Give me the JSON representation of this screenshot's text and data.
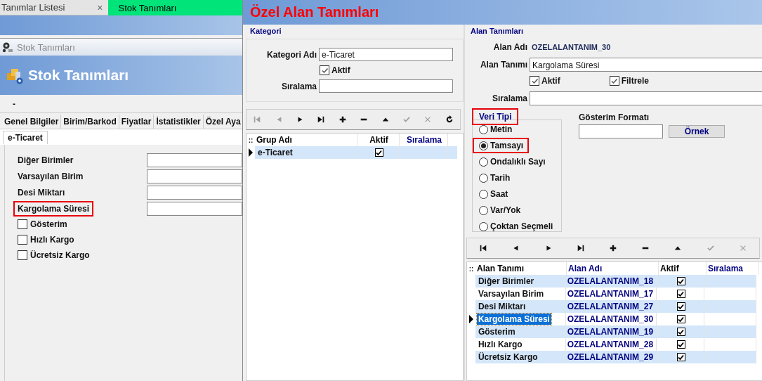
{
  "background": {
    "tabs": [
      {
        "label": "Tanımlar Listesi",
        "selected": false,
        "close": "×"
      },
      {
        "label": "Stok Tanımları",
        "selected": true
      }
    ],
    "window_title": "Stok Tanımları",
    "header_title": "Stok Tanımları",
    "strip_text": "-",
    "page_tabs": [
      "Genel Bilgiler",
      "Birim/Barkod",
      "Fiyatlar",
      "İstatistikler",
      "Özel Aya"
    ],
    "sub_tab": "e-Ticaret",
    "fields": [
      {
        "label": "Diğer Birimler",
        "highlighted": false
      },
      {
        "label": "Varsayılan  Birim",
        "highlighted": false
      },
      {
        "label": "Desi Miktarı",
        "highlighted": false
      },
      {
        "label": "Kargolama Süresi",
        "highlighted": true
      }
    ],
    "checkboxes": [
      {
        "label": "Gösterim",
        "checked": false
      },
      {
        "label": "Hızlı Kargo",
        "checked": false
      },
      {
        "label": "Ücretsiz Kargo",
        "checked": false
      }
    ]
  },
  "dialog": {
    "title": "Özel Alan Tanımları",
    "kategori": {
      "legend": "Kategori",
      "name_label": "Kategori Adı",
      "name_value": "e-Ticaret",
      "aktif": {
        "label": "Aktif",
        "checked": true
      },
      "sira_label": "Sıralama",
      "toolbar": [
        {
          "kind": "first",
          "disabled": true
        },
        {
          "kind": "prev",
          "disabled": true
        },
        {
          "kind": "next",
          "disabled": false
        },
        {
          "kind": "last",
          "disabled": false
        },
        {
          "kind": "add",
          "disabled": false
        },
        {
          "kind": "remove",
          "disabled": false
        },
        {
          "kind": "up",
          "disabled": false
        },
        {
          "kind": "confirm",
          "disabled": true
        },
        {
          "kind": "cancel",
          "disabled": true
        },
        {
          "kind": "refresh",
          "disabled": false
        }
      ],
      "grid": {
        "grip": "::",
        "columns": [
          {
            "label": "Grup Adı",
            "color": "#000000"
          },
          {
            "label": "Aktif",
            "color": "#000000"
          },
          {
            "label": "Sıralama",
            "color": "#000080"
          }
        ],
        "rows": [
          {
            "name": "e-Ticaret",
            "aktif": true,
            "selected": true
          }
        ]
      }
    },
    "alan": {
      "legend": "Alan Tanımları",
      "adi_label": "Alan Adı",
      "adi_value": "OZELALANTANIM_30",
      "tanim_label": "Alan Tanımı",
      "tanim_value": "Kargolama Süresi",
      "checks": [
        {
          "label": "Aktif",
          "checked": true
        },
        {
          "label": "Filtrele",
          "checked": true
        }
      ],
      "sira_label": "Sıralama",
      "veri_tipi": {
        "legend": "Veri Tipi",
        "highlighted": true,
        "options": [
          {
            "label": "Metin",
            "selected": false,
            "highlighted": false
          },
          {
            "label": "Tamsayı",
            "selected": true,
            "highlighted": true
          },
          {
            "label": "Ondalıklı Sayı",
            "selected": false,
            "highlighted": false
          },
          {
            "label": "Tarih",
            "selected": false,
            "highlighted": false
          },
          {
            "label": "Saat",
            "selected": false,
            "highlighted": false
          },
          {
            "label": "Var/Yok",
            "selected": false,
            "highlighted": false
          },
          {
            "label": "Çoktan Seçmeli",
            "selected": false,
            "highlighted": false
          }
        ]
      },
      "format_label": "Gösterim Formatı",
      "sample_button": "Örnek",
      "toolbar": [
        {
          "kind": "first",
          "disabled": false
        },
        {
          "kind": "prev",
          "disabled": false
        },
        {
          "kind": "next",
          "disabled": false
        },
        {
          "kind": "last",
          "disabled": false
        },
        {
          "kind": "add",
          "disabled": false
        },
        {
          "kind": "remove",
          "disabled": false
        },
        {
          "kind": "up",
          "disabled": false
        },
        {
          "kind": "confirm",
          "disabled": true
        },
        {
          "kind": "cancel",
          "disabled": true
        }
      ],
      "grid": {
        "grip": "::",
        "columns": [
          {
            "label": "Alan Tanımı",
            "color": "#000000"
          },
          {
            "label": "Alan Adı",
            "color": "#000080"
          },
          {
            "label": "Aktif",
            "color": "#000000"
          },
          {
            "label": "Sıralama",
            "color": "#000080"
          }
        ],
        "rows": [
          {
            "name": "Diğer Birimler",
            "field": "OZELALANTANIM_18",
            "aktif": true,
            "selected": false
          },
          {
            "name": "Varsayılan  Birim",
            "field": "OZELALANTANIM_17",
            "aktif": true,
            "selected": false
          },
          {
            "name": "Desi Miktarı",
            "field": "OZELALANTANIM_27",
            "aktif": true,
            "selected": false
          },
          {
            "name": "Kargolama Süresi",
            "field": "OZELALANTANIM_30",
            "aktif": true,
            "selected": true
          },
          {
            "name": "Gösterim",
            "field": "OZELALANTANIM_19",
            "aktif": true,
            "selected": false
          },
          {
            "name": "Hızlı Kargo",
            "field": "OZELALANTANIM_28",
            "aktif": true,
            "selected": false
          },
          {
            "name": "Ücretsiz Kargo",
            "field": "OZELALANTANIM_29",
            "aktif": true,
            "selected": false
          }
        ]
      }
    }
  }
}
